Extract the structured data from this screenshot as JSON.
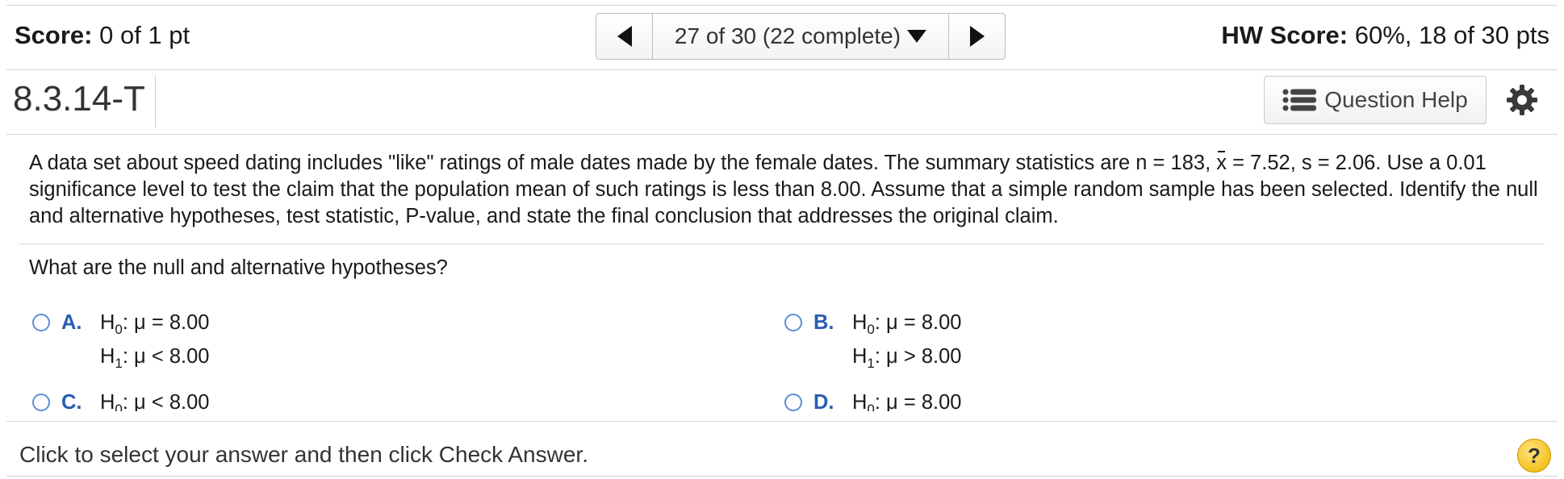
{
  "header": {
    "score_label": "Score:",
    "score_value": "0 of 1 pt",
    "nav_label": "27 of 30 (22 complete)",
    "hw_label": "HW Score:",
    "hw_value": "60%, 18 of 30 pts"
  },
  "question": {
    "id": "8.3.14-T",
    "help_label": "Question Help",
    "stem_part1": "A data set about speed dating includes \"like\" ratings of male dates made by the female dates. The summary statistics are n = 183, ",
    "xbar_symbol": "x",
    "stem_part2": " = 7.52, s = 2.06. Use a 0.01 significance level to test the claim that the population mean of such ratings is less than 8.00. Assume that a simple random sample has been selected. Identify the null and alternative hypotheses, test statistic, P-value, and state the final conclusion that addresses the original claim.",
    "prompt": "What are the null and alternative hypotheses?"
  },
  "options": {
    "A": {
      "letter": "A.",
      "h0_rel": ": μ = 8.00",
      "h1_rel": ": μ < 8.00"
    },
    "B": {
      "letter": "B.",
      "h0_rel": ": μ = 8.00",
      "h1_rel": ": μ > 8.00"
    },
    "C": {
      "letter": "C.",
      "h0_rel": ": μ < 8.00",
      "h1_rel": ""
    },
    "D": {
      "letter": "D.",
      "h0_rel": ": μ = 8.00",
      "h1_rel": ""
    }
  },
  "footer": {
    "instruction": "Click to select your answer and then click Check Answer.",
    "help_icon": "?"
  }
}
